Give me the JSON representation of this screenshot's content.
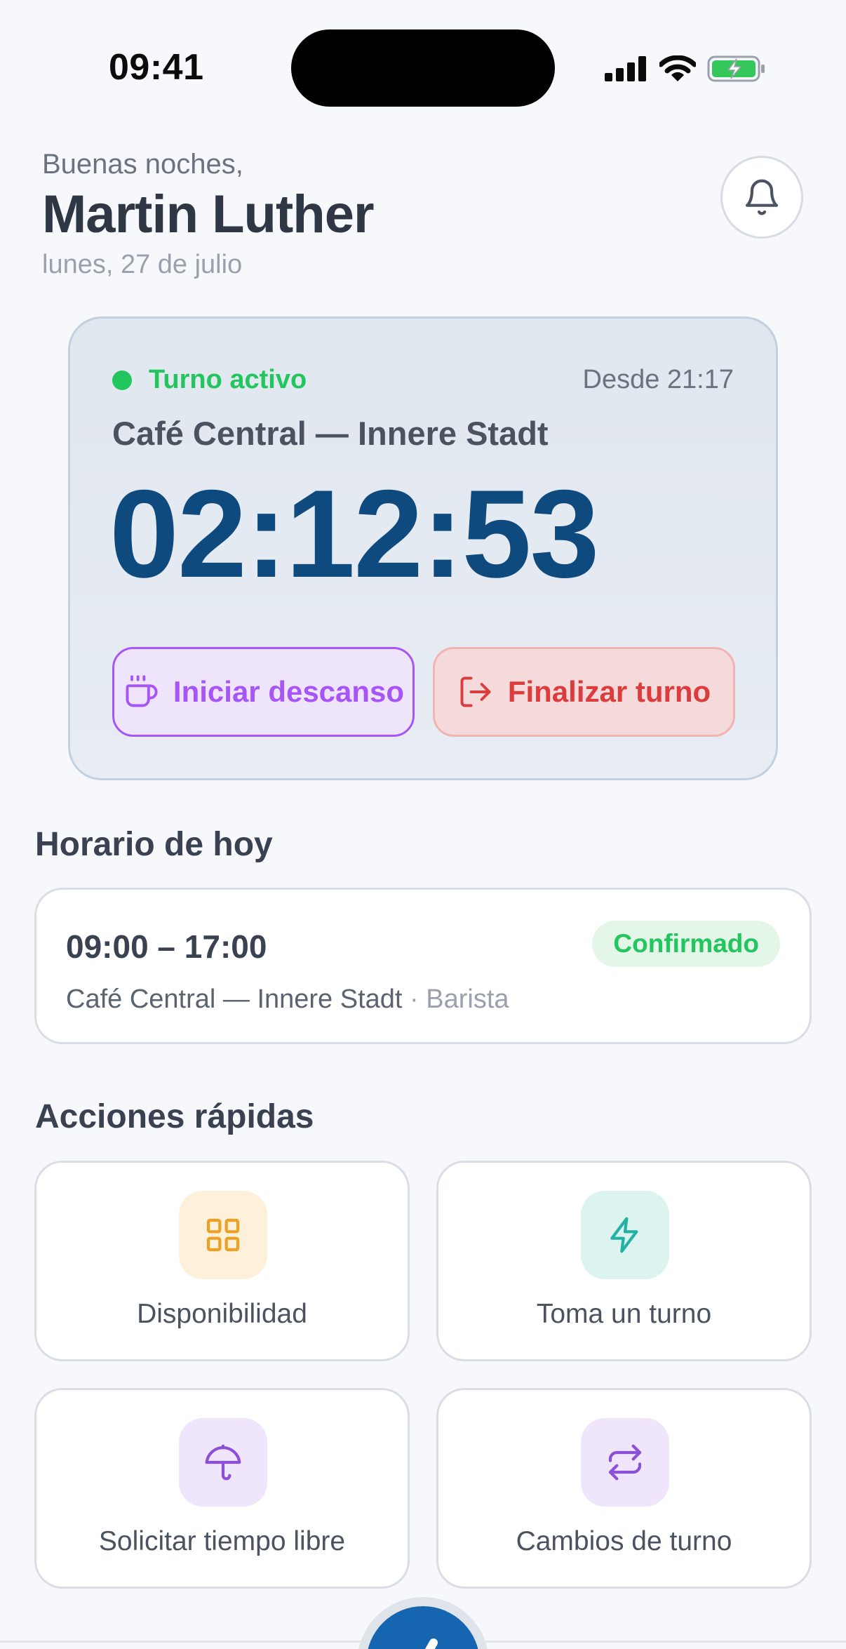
{
  "status_bar": {
    "time": "09:41"
  },
  "header": {
    "greeting": "Buenas noches,",
    "name": "Martin Luther",
    "date": "lunes, 27 de julio"
  },
  "active_shift": {
    "status": "Turno activo",
    "since": "Desde 21:17",
    "location": "Café Central — Innere Stadt",
    "timer": "02:12:53",
    "break_button": "Iniciar descanso",
    "end_button": "Finalizar turno"
  },
  "today": {
    "title": "Horario de hoy",
    "time_range": "09:00 – 17:00",
    "status_badge": "Confirmado",
    "location": "Café Central — Innere Stadt",
    "role": "· Barista"
  },
  "quick_actions": {
    "title": "Acciones rápidas",
    "items": [
      {
        "label": "Disponibilidad",
        "icon": "grid-icon",
        "color": "#f0a020",
        "bg": "#fdf1dc"
      },
      {
        "label": "Toma un turno",
        "icon": "bolt-icon",
        "color": "#20b2a2",
        "bg": "#ddf3f0"
      },
      {
        "label": "Solicitar tiempo libre",
        "icon": "umbrella-icon",
        "color": "#8b4fd8",
        "bg": "#efe6fb"
      },
      {
        "label": "Cambios de turno",
        "icon": "swap-icon",
        "color": "#8b4fd8",
        "bg": "#efe6fb"
      }
    ]
  },
  "colors": {
    "accent_green": "#22c55e",
    "timer_blue": "#0f4a7f",
    "break_purple": "#a855f7",
    "end_red": "#dc3c3c"
  }
}
